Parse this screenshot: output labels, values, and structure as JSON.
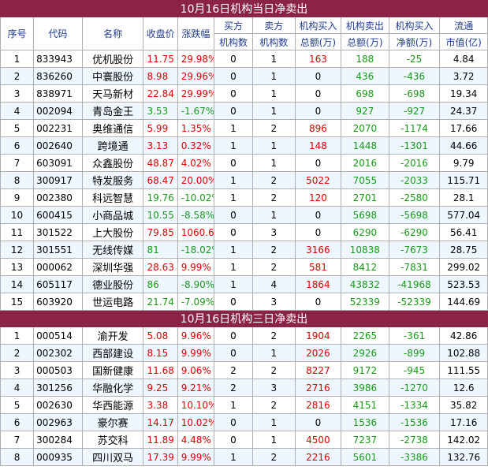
{
  "section1": {
    "title": "10月16日机构当日净卖出",
    "headers": {
      "seq": "序号",
      "code": "代码",
      "name": "名称",
      "price": "收盘价",
      "change": "涨跌幅",
      "buyers_top": "买方",
      "buyers_bottom": "机构数",
      "sellers_top": "卖方",
      "sellers_bottom": "机构数",
      "inst_buy_top": "机构买入",
      "inst_buy_bottom": "总额(万)",
      "inst_sell_top": "机构卖出",
      "inst_sell_bottom": "总额(万)",
      "net_top": "机构买入",
      "net_bottom": "净额(万)",
      "mcap_top": "流通",
      "mcap_bottom": "市值(亿)"
    },
    "rows": [
      {
        "seq": "1",
        "code": "833943",
        "name": "优机股份",
        "price": "11.75",
        "change": "29.98%",
        "buyers": "0",
        "sellers": "1",
        "buy": "163",
        "sell": "188",
        "net": "-25",
        "mcap": "4.84"
      },
      {
        "seq": "2",
        "code": "836260",
        "name": "中寰股份",
        "price": "8.98",
        "change": "29.96%",
        "buyers": "0",
        "sellers": "1",
        "buy": "0",
        "sell": "436",
        "net": "-436",
        "mcap": "3.72"
      },
      {
        "seq": "3",
        "code": "838971",
        "name": "天马新材",
        "price": "22.84",
        "change": "29.99%",
        "buyers": "0",
        "sellers": "1",
        "buy": "0",
        "sell": "698",
        "net": "-698",
        "mcap": "19.34"
      },
      {
        "seq": "4",
        "code": "002094",
        "name": "青岛金王",
        "price": "3.53",
        "change": "-1.67%",
        "buyers": "0",
        "sellers": "1",
        "buy": "0",
        "sell": "927",
        "net": "-927",
        "mcap": "24.37"
      },
      {
        "seq": "5",
        "code": "002231",
        "name": "奥维通信",
        "price": "5.99",
        "change": "1.35%",
        "buyers": "1",
        "sellers": "2",
        "buy": "896",
        "sell": "2070",
        "net": "-1174",
        "mcap": "17.66"
      },
      {
        "seq": "6",
        "code": "002640",
        "name": "跨境通",
        "price": "3.13",
        "change": "0.32%",
        "buyers": "1",
        "sellers": "1",
        "buy": "148",
        "sell": "1448",
        "net": "-1301",
        "mcap": "44.66"
      },
      {
        "seq": "7",
        "code": "603091",
        "name": "众鑫股份",
        "price": "48.87",
        "change": "4.02%",
        "buyers": "0",
        "sellers": "1",
        "buy": "0",
        "sell": "2016",
        "net": "-2016",
        "mcap": "9.79"
      },
      {
        "seq": "8",
        "code": "300917",
        "name": "特发服务",
        "price": "68.47",
        "change": "20.00%",
        "buyers": "1",
        "sellers": "2",
        "buy": "5022",
        "sell": "7055",
        "net": "-2033",
        "mcap": "115.71"
      },
      {
        "seq": "9",
        "code": "002380",
        "name": "科远智慧",
        "price": "19.76",
        "change": "-10.02%",
        "buyers": "1",
        "sellers": "2",
        "buy": "120",
        "sell": "2701",
        "net": "-2580",
        "mcap": "28.1"
      },
      {
        "seq": "10",
        "code": "600415",
        "name": "小商品城",
        "price": "10.55",
        "change": "-8.58%",
        "buyers": "0",
        "sellers": "1",
        "buy": "0",
        "sell": "5698",
        "net": "-5698",
        "mcap": "577.04"
      },
      {
        "seq": "11",
        "code": "301522",
        "name": "上大股份",
        "price": "79.85",
        "change": "1060.61%",
        "buyers": "0",
        "sellers": "3",
        "buy": "0",
        "sell": "6290",
        "net": "-6290",
        "mcap": "56.41"
      },
      {
        "seq": "12",
        "code": "301551",
        "name": "无线传媒",
        "price": "81",
        "change": "-18.02%",
        "buyers": "1",
        "sellers": "2",
        "buy": "3166",
        "sell": "10838",
        "net": "-7673",
        "mcap": "28.75"
      },
      {
        "seq": "13",
        "code": "000062",
        "name": "深圳华强",
        "price": "28.63",
        "change": "9.99%",
        "buyers": "1",
        "sellers": "2",
        "buy": "581",
        "sell": "8412",
        "net": "-7831",
        "mcap": "299.02"
      },
      {
        "seq": "14",
        "code": "605117",
        "name": "德业股份",
        "price": "86",
        "change": "-8.90%",
        "buyers": "1",
        "sellers": "4",
        "buy": "1864",
        "sell": "43832",
        "net": "-41968",
        "mcap": "523.53"
      },
      {
        "seq": "15",
        "code": "603920",
        "name": "世运电路",
        "price": "21.74",
        "change": "-7.09%",
        "buyers": "0",
        "sellers": "3",
        "buy": "0",
        "sell": "52339",
        "net": "-52339",
        "mcap": "144.69"
      }
    ]
  },
  "section2": {
    "title": "10月16日机构三日净卖出",
    "rows": [
      {
        "seq": "1",
        "code": "000514",
        "name": "渝开发",
        "price": "5.08",
        "change": "9.96%",
        "buyers": "0",
        "sellers": "2",
        "buy": "1904",
        "sell": "2265",
        "net": "-361",
        "mcap": "42.86"
      },
      {
        "seq": "2",
        "code": "002302",
        "name": "西部建设",
        "price": "8.15",
        "change": "9.99%",
        "buyers": "0",
        "sellers": "1",
        "buy": "2026",
        "sell": "2926",
        "net": "-899",
        "mcap": "102.88"
      },
      {
        "seq": "3",
        "code": "000503",
        "name": "国新健康",
        "price": "11.68",
        "change": "9.06%",
        "buyers": "2",
        "sellers": "2",
        "buy": "8227",
        "sell": "9172",
        "net": "-945",
        "mcap": "111.55"
      },
      {
        "seq": "4",
        "code": "301256",
        "name": "华融化学",
        "price": "9.25",
        "change": "9.21%",
        "buyers": "2",
        "sellers": "3",
        "buy": "2716",
        "sell": "3986",
        "net": "-1270",
        "mcap": "12.6"
      },
      {
        "seq": "5",
        "code": "002630",
        "name": "华西能源",
        "price": "3.38",
        "change": "10.10%",
        "buyers": "1",
        "sellers": "2",
        "buy": "2816",
        "sell": "4151",
        "net": "-1334",
        "mcap": "35.82"
      },
      {
        "seq": "6",
        "code": "002963",
        "name": "豪尔赛",
        "price": "14.17",
        "change": "10.02%",
        "buyers": "0",
        "sellers": "1",
        "buy": "0",
        "sell": "1536",
        "net": "-1536",
        "mcap": "17.16"
      },
      {
        "seq": "7",
        "code": "300284",
        "name": "苏交科",
        "price": "11.89",
        "change": "4.48%",
        "buyers": "0",
        "sellers": "1",
        "buy": "4500",
        "sell": "7237",
        "net": "-2738",
        "mcap": "142.02"
      },
      {
        "seq": "8",
        "code": "000935",
        "name": "四川双马",
        "price": "17.39",
        "change": "9.99%",
        "buyers": "1",
        "sellers": "2",
        "buy": "2216",
        "sell": "5601",
        "net": "-3386",
        "mcap": "132.76"
      }
    ]
  },
  "colors": {
    "title_bg": "#8b2346",
    "header_text": "#1f3b8f",
    "up": "#e00000",
    "down": "#1a9a1a",
    "alt_row": "#eef6ff"
  }
}
